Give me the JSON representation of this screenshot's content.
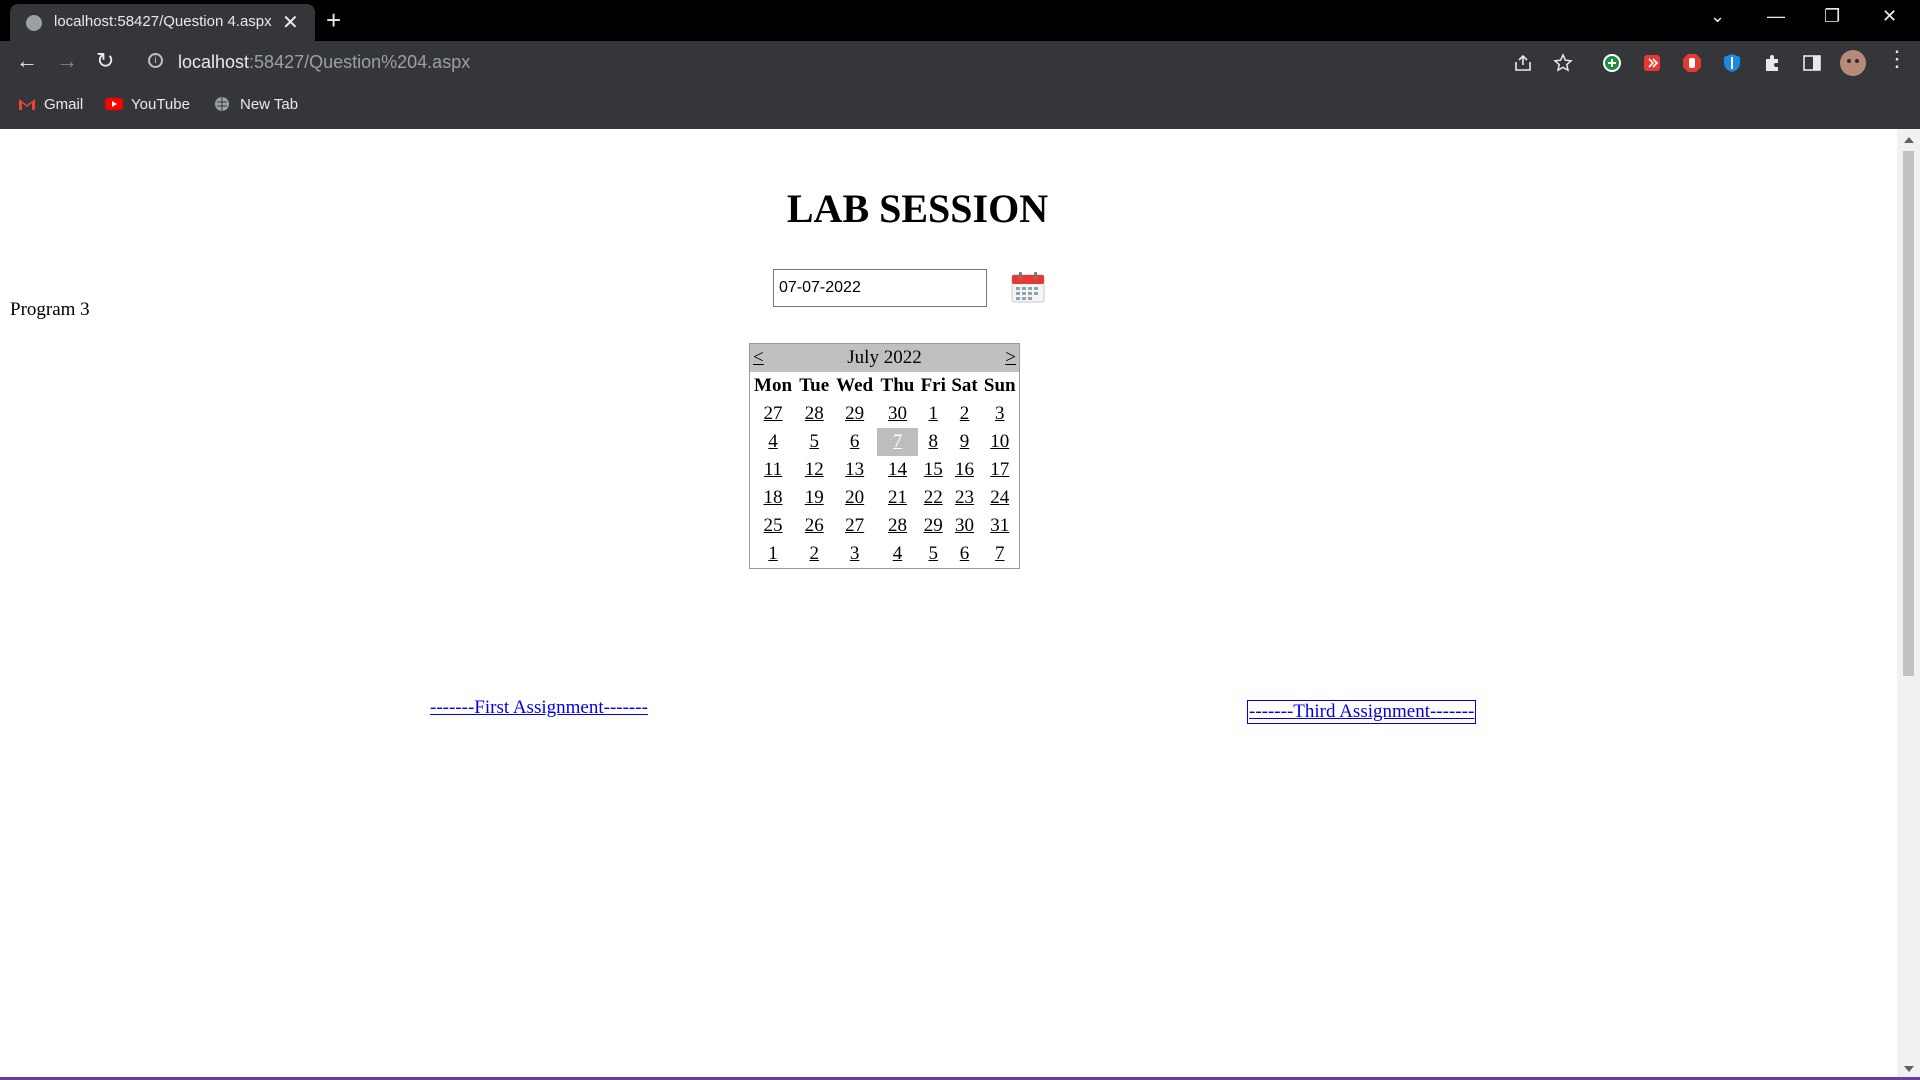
{
  "browser": {
    "tab_title": "localhost:58427/Question 4.aspx",
    "url_host": "localhost",
    "url_path": ":58427/Question%204.aspx",
    "bookmarks": [
      "Gmail",
      "YouTube",
      "New Tab"
    ]
  },
  "page": {
    "heading": "LAB SESSION",
    "date_value": "07-07-2022",
    "program_label": "Program 3",
    "calendar": {
      "prev": "<",
      "next": ">",
      "month_title": "July 2022",
      "weekdays": [
        "Mon",
        "Tue",
        "Wed",
        "Thu",
        "Fri",
        "Sat",
        "Sun"
      ],
      "weeks": [
        [
          "27",
          "28",
          "29",
          "30",
          "1",
          "2",
          "3"
        ],
        [
          "4",
          "5",
          "6",
          "7",
          "8",
          "9",
          "10"
        ],
        [
          "11",
          "12",
          "13",
          "14",
          "15",
          "16",
          "17"
        ],
        [
          "18",
          "19",
          "20",
          "21",
          "22",
          "23",
          "24"
        ],
        [
          "25",
          "26",
          "27",
          "28",
          "29",
          "30",
          "31"
        ],
        [
          "1",
          "2",
          "3",
          "4",
          "5",
          "6",
          "7"
        ]
      ],
      "selected_day": "7"
    },
    "links": {
      "first": "-------First Assignment-------",
      "third": "-------Third Assignment-------"
    }
  }
}
